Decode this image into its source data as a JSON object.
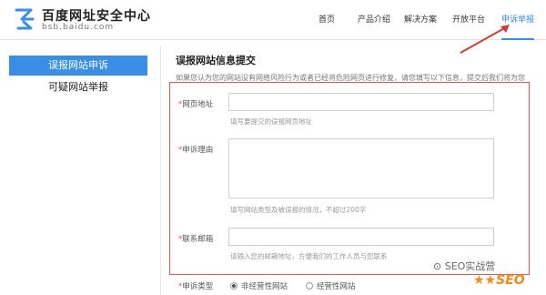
{
  "brand": {
    "title": "百度网址安全中心",
    "subtitle": "bsb.baidu.com"
  },
  "nav": {
    "items": [
      "首页",
      "产品介绍",
      "解决方案",
      "开放平台",
      "申诉举报"
    ],
    "active_index": 4
  },
  "sidebar": {
    "items": [
      "误报网站申诉",
      "可疑网站举报"
    ]
  },
  "content": {
    "title": "误报网站信息提交",
    "intro": "如果您认为您的网站没有网络风险行为或者已经将危险网页进行修复，请您填写以下信息，提交后我们将为您",
    "fields": {
      "url": {
        "label": "网页地址",
        "required_mark": "*",
        "hint": "填写要提交的误报网页地址"
      },
      "reason": {
        "label": "申诉理由",
        "required_mark": "*",
        "hint": "填写网站类型及被误报的情况，不超过200字"
      },
      "email": {
        "label": "联系邮箱",
        "required_mark": "*",
        "hint": "请输入您的邮箱地址，方便我们的工作人员与您联系"
      },
      "type": {
        "label": "申诉类型",
        "required_mark": "*",
        "options": [
          "非经营性网站",
          "经营性网站"
        ],
        "selected_index": 0
      }
    }
  },
  "watermark": {
    "text": "SEO实战营",
    "logo_text": "SEO"
  },
  "colors": {
    "accent": "#3a8ee6",
    "annotation": "#e0585a"
  }
}
